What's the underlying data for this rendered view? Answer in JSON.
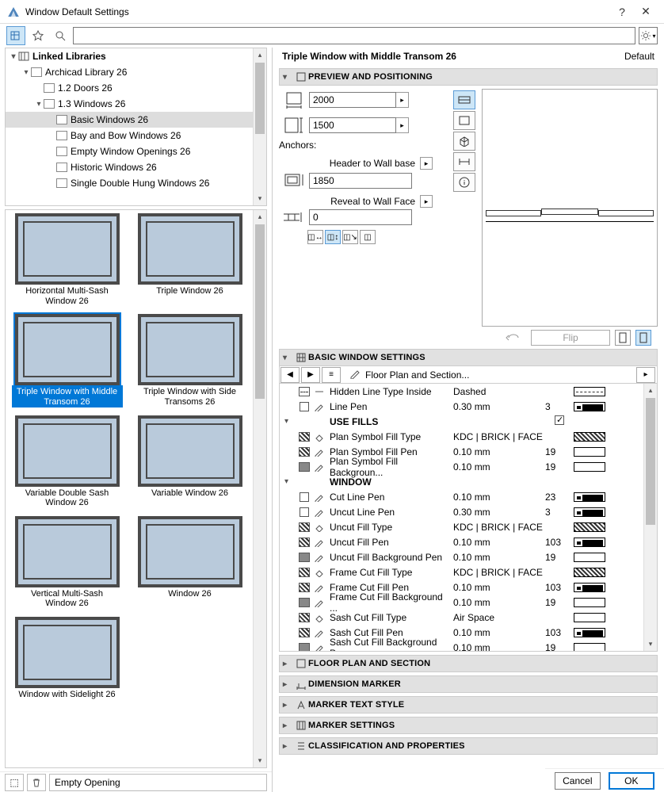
{
  "window": {
    "title": "Window Default Settings"
  },
  "toolbar": {
    "search_placeholder": ""
  },
  "tree": {
    "header": "Linked Libraries",
    "items": [
      {
        "label": "Archicad Library 26",
        "indent": 1,
        "expand": "down"
      },
      {
        "label": "1.2 Doors 26",
        "indent": 2,
        "expand": ""
      },
      {
        "label": "1.3 Windows 26",
        "indent": 2,
        "expand": "down"
      },
      {
        "label": "Basic Windows 26",
        "indent": 3,
        "expand": "",
        "selected": true
      },
      {
        "label": "Bay and Bow Windows 26",
        "indent": 3,
        "expand": ""
      },
      {
        "label": "Empty Window Openings 26",
        "indent": 3,
        "expand": ""
      },
      {
        "label": "Historic Windows 26",
        "indent": 3,
        "expand": ""
      },
      {
        "label": "Single Double Hung Windows 26",
        "indent": 3,
        "expand": ""
      }
    ]
  },
  "thumbs": [
    {
      "label": "Horizontal Multi-Sash Window 26"
    },
    {
      "label": "Triple Window 26"
    },
    {
      "label": "Triple Window with Middle Transom 26",
      "selected": true
    },
    {
      "label": "Triple Window with Side Transoms 26"
    },
    {
      "label": "Variable Double Sash Window 26"
    },
    {
      "label": "Variable Window 26"
    },
    {
      "label": "Vertical Multi-Sash Window 26"
    },
    {
      "label": "Window 26"
    },
    {
      "label": "Window with Sidelight 26"
    }
  ],
  "bottombar": {
    "label": "Empty Opening"
  },
  "right": {
    "name": "Triple Window with Middle Transom 26",
    "default": "Default",
    "panels": {
      "preview": "PREVIEW AND POSITIONING",
      "basic": "BASIC WINDOW SETTINGS",
      "fps": "FLOOR PLAN AND SECTION",
      "dm": "DIMENSION MARKER",
      "mts": "MARKER TEXT STYLE",
      "ms": "MARKER SETTINGS",
      "cap": "CLASSIFICATION AND PROPERTIES"
    },
    "preview": {
      "width": "2000",
      "height": "1500",
      "anchors_label": "Anchors:",
      "header_label": "Header to Wall base",
      "header_value": "1850",
      "reveal_label": "Reveal to Wall Face",
      "reveal_value": "0",
      "flip": "Flip"
    },
    "bws_nav": "Floor Plan and Section...",
    "params": [
      {
        "type": "row",
        "name": "Hidden Line Type Inside",
        "val": "Dashed",
        "ext": "",
        "swatch": "dash",
        "ico": "dash",
        "ico2": "line"
      },
      {
        "type": "row",
        "name": "Line Pen",
        "val": "0.30 mm",
        "ext": "3",
        "swatch": "line",
        "ico": "chk",
        "ico2": "pen"
      },
      {
        "type": "group",
        "name": "USE FILLS",
        "checked": true
      },
      {
        "type": "row",
        "name": "Plan Symbol Fill Type",
        "val": "KDC | BRICK | FACE",
        "ext": "",
        "swatch": "hatch",
        "ico": "hatch",
        "ico2": "fill"
      },
      {
        "type": "row",
        "name": "Plan Symbol Fill Pen",
        "val": "0.10 mm",
        "ext": "19",
        "swatch": "white",
        "ico": "hatch",
        "ico2": "pen"
      },
      {
        "type": "row",
        "name": "Plan Symbol Fill Backgroun...",
        "val": "0.10 mm",
        "ext": "19",
        "swatch": "white",
        "ico": "solid",
        "ico2": "pen"
      },
      {
        "type": "group",
        "name": "WINDOW"
      },
      {
        "type": "row",
        "name": "Cut Line Pen",
        "val": "0.10 mm",
        "ext": "23",
        "swatch": "line",
        "ico": "chk",
        "ico2": "pen"
      },
      {
        "type": "row",
        "name": "Uncut Line Pen",
        "val": "0.30 mm",
        "ext": "3",
        "swatch": "line",
        "ico": "chk",
        "ico2": "pen"
      },
      {
        "type": "row",
        "name": "Uncut Fill Type",
        "val": "KDC | BRICK | FACE",
        "ext": "",
        "swatch": "hatch",
        "ico": "hatch",
        "ico2": "fill"
      },
      {
        "type": "row",
        "name": "Uncut Fill Pen",
        "val": "0.10 mm",
        "ext": "103",
        "swatch": "line",
        "ico": "hatch",
        "ico2": "pen"
      },
      {
        "type": "row",
        "name": "Uncut Fill Background Pen",
        "val": "0.10 mm",
        "ext": "19",
        "swatch": "white",
        "ico": "solid",
        "ico2": "pen"
      },
      {
        "type": "row",
        "name": "Frame Cut Fill Type",
        "val": "KDC | BRICK | FACE",
        "ext": "",
        "swatch": "hatch",
        "ico": "hatch",
        "ico2": "fill"
      },
      {
        "type": "row",
        "name": "Frame Cut Fill Pen",
        "val": "0.10 mm",
        "ext": "103",
        "swatch": "line",
        "ico": "hatch",
        "ico2": "pen"
      },
      {
        "type": "row",
        "name": "Frame Cut Fill Background ...",
        "val": "0.10 mm",
        "ext": "19",
        "swatch": "white",
        "ico": "solid",
        "ico2": "pen"
      },
      {
        "type": "row",
        "name": "Sash Cut Fill Type",
        "val": "Air Space",
        "ext": "",
        "swatch": "white",
        "ico": "hatch",
        "ico2": "fill"
      },
      {
        "type": "row",
        "name": "Sash Cut Fill Pen",
        "val": "0.10 mm",
        "ext": "103",
        "swatch": "line",
        "ico": "hatch",
        "ico2": "pen"
      },
      {
        "type": "row",
        "name": "Sash Cut Fill Background Pen",
        "val": "0.10 mm",
        "ext": "19",
        "swatch": "white",
        "ico": "solid",
        "ico2": "pen"
      }
    ]
  },
  "buttons": {
    "cancel": "Cancel",
    "ok": "OK"
  }
}
